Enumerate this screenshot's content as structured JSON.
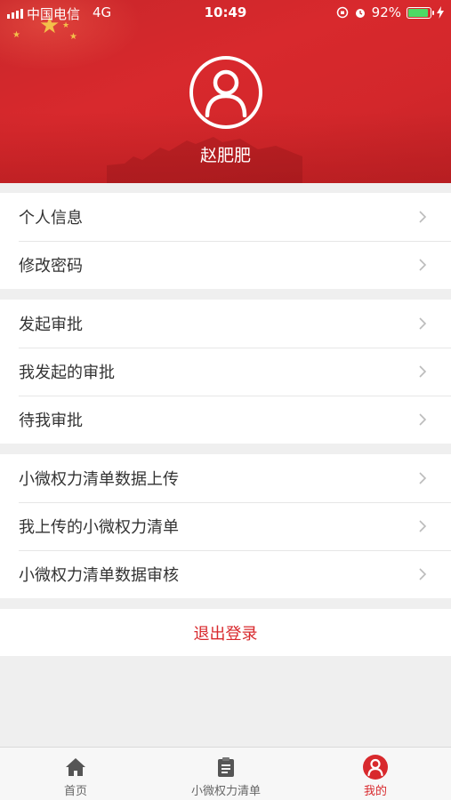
{
  "status_bar": {
    "carrier": "中国电信",
    "network": "4G",
    "time": "10:49",
    "battery": "92%",
    "battery_level": 0.92
  },
  "profile": {
    "username": "赵肥肥"
  },
  "menu": {
    "group1": [
      {
        "label": "个人信息"
      },
      {
        "label": "修改密码"
      }
    ],
    "group2": [
      {
        "label": "发起审批"
      },
      {
        "label": "我发起的审批"
      },
      {
        "label": "待我审批"
      }
    ],
    "group3": [
      {
        "label": "小微权力清单数据上传"
      },
      {
        "label": "我上传的小微权力清单"
      },
      {
        "label": "小微权力清单数据审核"
      }
    ]
  },
  "logout_label": "退出登录",
  "tabbar": {
    "tabs": [
      {
        "label": "首页",
        "icon": "home-icon"
      },
      {
        "label": "小微权力清单",
        "icon": "clipboard-icon"
      },
      {
        "label": "我的",
        "icon": "user-icon",
        "active": true
      }
    ]
  },
  "colors": {
    "brand_red": "#d8292d",
    "background": "#efefef"
  }
}
